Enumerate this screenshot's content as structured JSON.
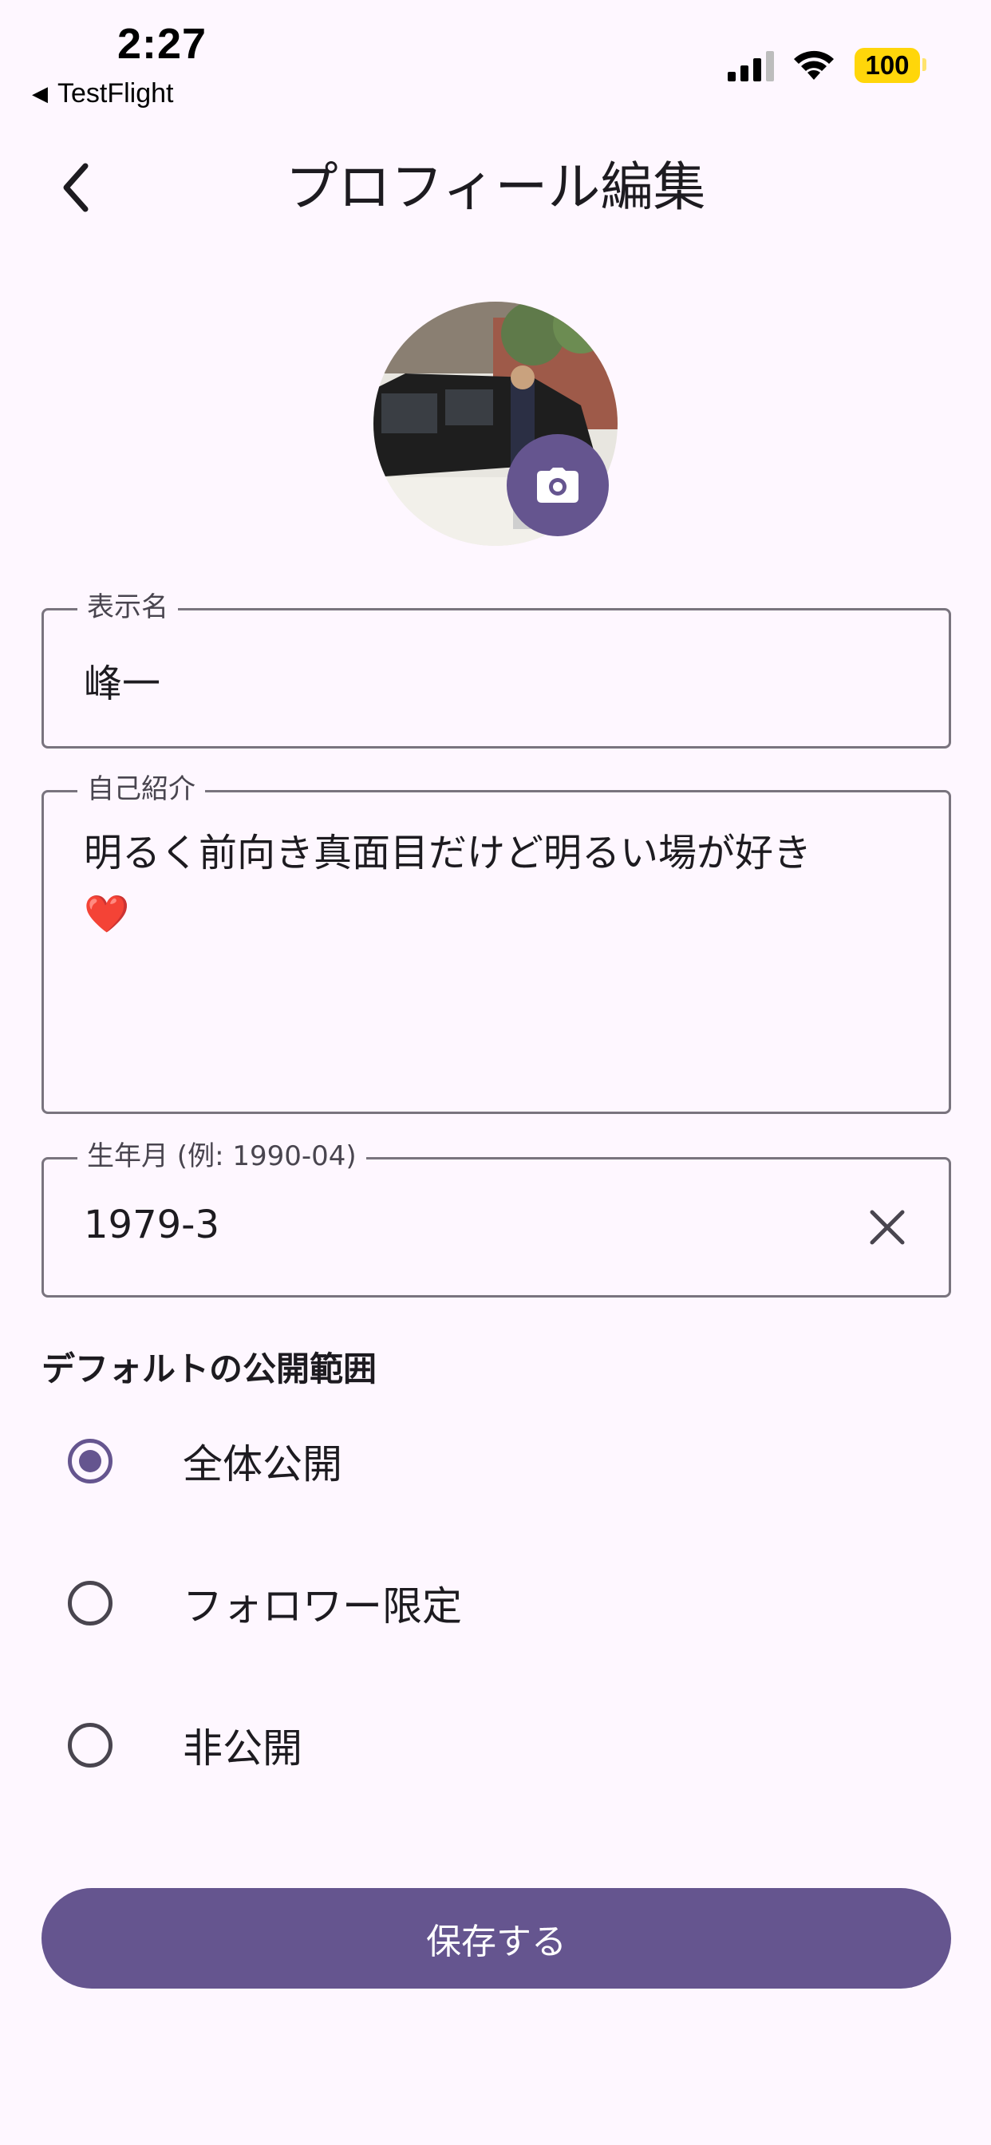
{
  "status_bar": {
    "time": "2:27",
    "back_app": "TestFlight",
    "battery": "100",
    "icons": [
      "signal-icon",
      "wifi-icon",
      "battery-icon"
    ]
  },
  "header": {
    "title": "プロフィール編集",
    "back_icon": "chevron-left-icon"
  },
  "avatar": {
    "camera_icon": "camera-icon"
  },
  "fields": {
    "display_name": {
      "label": "表示名",
      "value": "峰一"
    },
    "bio": {
      "label": "自己紹介",
      "value": "明るく前向き真面目だけど明るい場が好き",
      "emoji": "❤️"
    },
    "birth": {
      "label": "生年月 (例: 1990-04)",
      "value": "1979-3",
      "clear_icon": "close-icon"
    }
  },
  "visibility": {
    "title": "デフォルトの公開範囲",
    "options": [
      {
        "label": "全体公開",
        "selected": true
      },
      {
        "label": "フォロワー限定",
        "selected": false
      },
      {
        "label": "非公開",
        "selected": false
      }
    ]
  },
  "actions": {
    "save_label": "保存する"
  },
  "colors": {
    "primary": "#65558F",
    "background": "#FEF7FF",
    "outline": "#79747E",
    "battery": "#FFD60A"
  }
}
